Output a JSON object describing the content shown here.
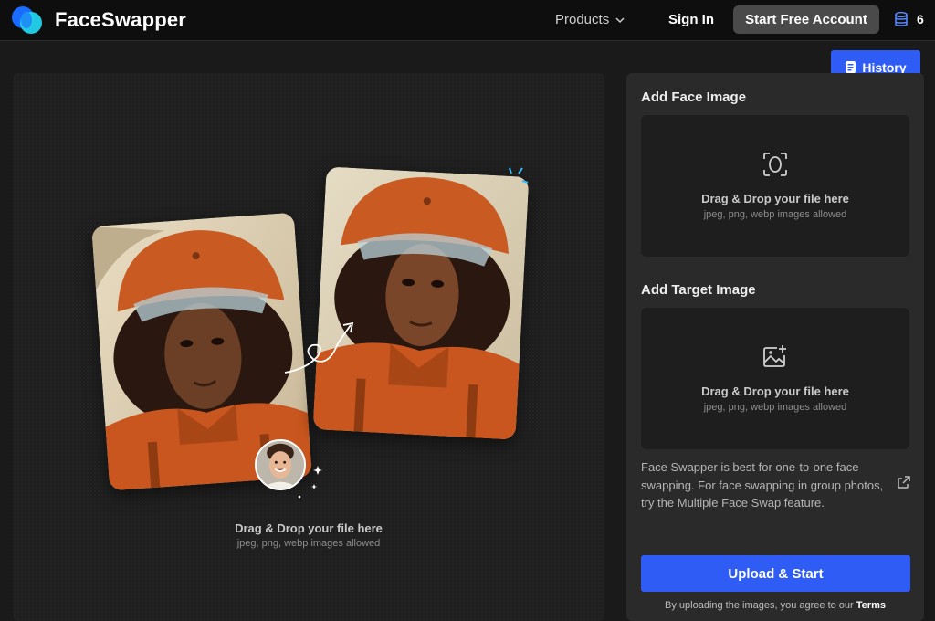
{
  "header": {
    "brand": "FaceSwapper",
    "nav_products": "Products",
    "sign_in": "Sign In",
    "start_account": "Start Free Account",
    "credits": "6",
    "icons": {
      "logo": "overlapping-circles-logo",
      "chevron": "chevron-down-icon",
      "credits": "coins-stack-icon"
    }
  },
  "history": {
    "label": "History",
    "icon": "history-file-icon"
  },
  "left_panel": {
    "drop_title": "Drag & Drop your file here",
    "drop_sub": "jpeg, png, webp images allowed"
  },
  "right_panel": {
    "face_section": {
      "title": "Add Face Image",
      "drop_title": "Drag & Drop your file here",
      "drop_sub": "jpeg, png, webp images allowed",
      "icon": "face-scan-icon"
    },
    "target_section": {
      "title": "Add Target Image",
      "drop_title": "Drag & Drop your file here",
      "drop_sub": "jpeg, png, webp images allowed",
      "icon": "image-add-icon"
    },
    "info_text": "Face Swapper is best for one-to-one face swapping. For face swapping in group photos, try the Multiple Face Swap feature.",
    "upload_button": "Upload & Start",
    "terms_prefix": "By uploading the images, you agree to our",
    "terms_link": "Terms"
  },
  "colors": {
    "accent": "#2f5cf5",
    "header_bg": "#0e0e0e",
    "panel_bg": "#2a2a2a",
    "logo_blue": "#1a6bff",
    "logo_cyan": "#22d3ee"
  }
}
